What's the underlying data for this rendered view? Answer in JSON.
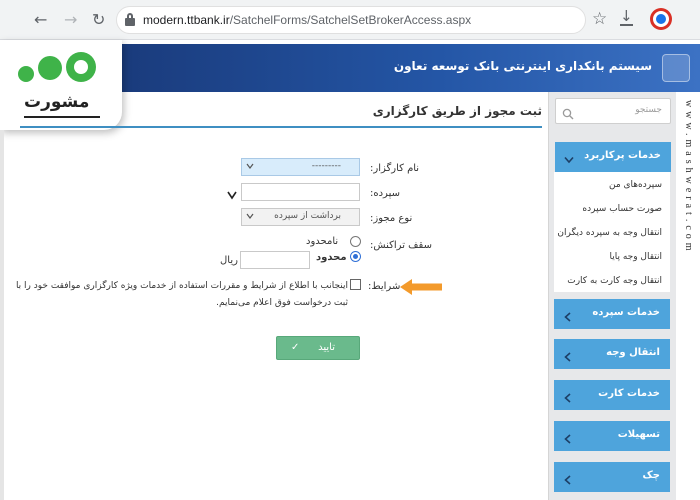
{
  "browser": {
    "back_icon": "←",
    "forward_icon": "→",
    "reload_icon": "↻",
    "url_host": "modern.ttbank.ir",
    "url_path": "/SatchelForms/SatchelSetBrokerAccess.aspx",
    "star_icon": "☆",
    "download_icon": "↓"
  },
  "banner": {
    "title": "سیستم بانکداری اینترنتی بانک توسعه تعاون"
  },
  "watermark": {
    "badge_word": "مشورت",
    "side_text": "www.mashwerat.com"
  },
  "form": {
    "title": "ثبت مجوز از طریق کارگزاری",
    "broker_label": "نام کارگزار:",
    "broker_value": "---------",
    "deposit_label": "سپرده:",
    "deposit_value": "",
    "permit_type_label": "نوع مجوز:",
    "permit_type_value": "برداشت از سپرده",
    "limit_label": "سقف تراکنش:",
    "unlimited_label": "نامحدود",
    "limited_label": "محدود",
    "amount_value": "",
    "currency_label": "ریال",
    "conditions_label": "شرایط:",
    "terms_text": "اینجانب با اطلاع از شرایط و مقررات استفاده از خدمات ویژه کارگزاری موافقت خود را با ثبت درخواست فوق اعلام می‌نمایم.",
    "submit_label": "تایید",
    "submit_icon": "✓",
    "accent_color": "#3f8fc2",
    "submit_color": "#6aba8c",
    "pointer_color": "#f39a2b"
  },
  "sidebar": {
    "search_placeholder": "جستجو",
    "expanded_menu": "خدمات پرکاربرد",
    "submenu_items": [
      "سپرده‌های من",
      "صورت حساب سپرده",
      "انتقال وجه به سپرده دیگران",
      "انتقال وجه پایا",
      "انتقال وجه کارت به کارت"
    ],
    "menus": [
      "خدمات سپرده",
      "انتقال وجه",
      "خدمات کارت",
      "تسهیلات",
      "چک"
    ],
    "menu_color": "#4ea4dc"
  }
}
